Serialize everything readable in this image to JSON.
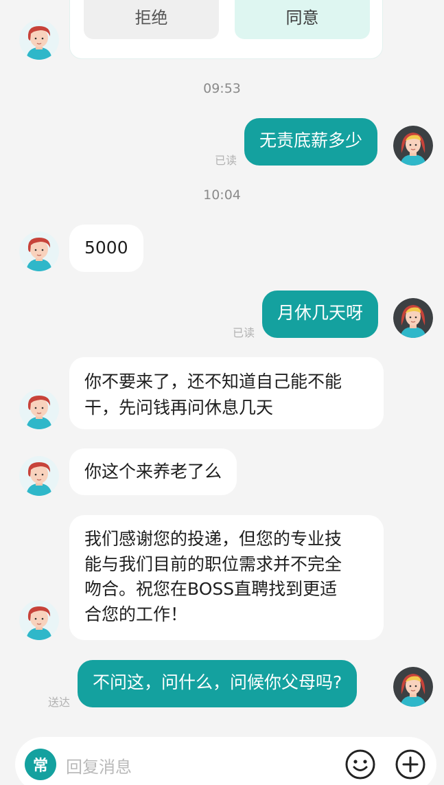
{
  "colors": {
    "accent": "#14a19f",
    "agree_bg": "#def6f1",
    "decline_bg": "#efefef"
  },
  "card": {
    "decline_label": "拒绝",
    "agree_label": "同意"
  },
  "messages": [
    {
      "time": "09:53"
    },
    {
      "side": "out",
      "text": "无责底薪多少",
      "status": "已读"
    },
    {
      "time": "10:04"
    },
    {
      "side": "in",
      "text": "5000"
    },
    {
      "side": "out",
      "text": "月休几天呀",
      "status": "已读"
    },
    {
      "side": "in",
      "lines": [
        "你不要来了，还不知道自己能不能",
        "干，先问钱再问休息几天"
      ]
    },
    {
      "side": "in",
      "text": "你这个来养老了么"
    },
    {
      "side": "in",
      "lines": [
        "我们感谢您的投递，但您的专业技",
        "能与我们目前的职位需求并不完全",
        "吻合。祝您在BOSS直聘找到更适",
        "合您的工作！"
      ]
    },
    {
      "side": "out",
      "text": "不问这，问什么，问候你父母吗?",
      "status": "送达"
    }
  ],
  "input": {
    "quick_phrase_label": "常",
    "placeholder": "回复消息",
    "emoji_icon": "smile-icon",
    "plus_icon": "plus-icon"
  }
}
